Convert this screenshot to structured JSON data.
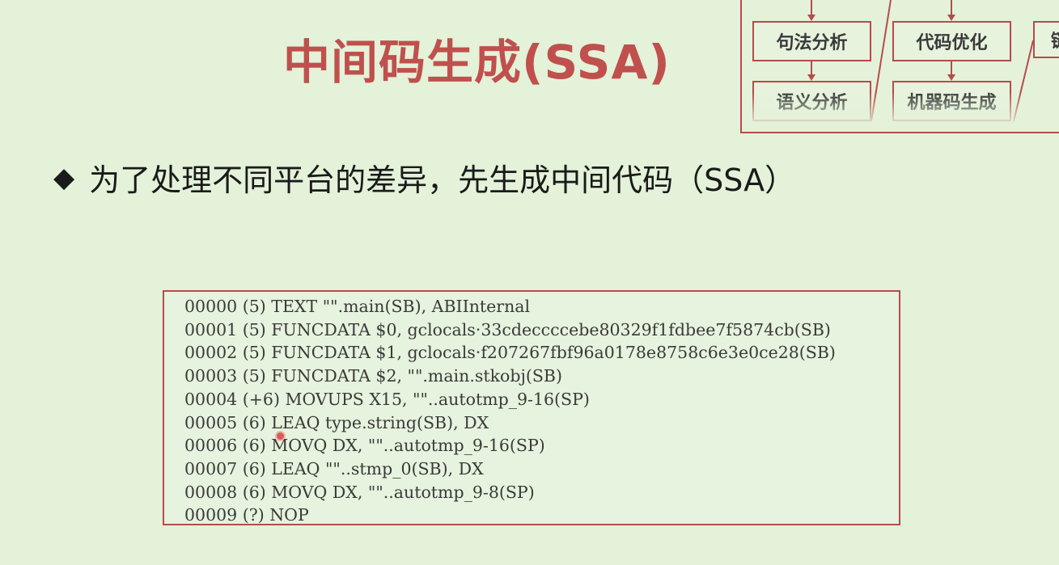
{
  "slide": {
    "title": "中间码生成(SSA)",
    "bullet_icon": "diamond-bullet-icon",
    "bullet_text": "为了处理不同平台的差异，先生成中间代码（SSA）"
  },
  "flowchart": {
    "boxes": [
      {
        "label": "句法分析"
      },
      {
        "label": "代码优化"
      },
      {
        "label": "语义分析"
      },
      {
        "label": "机器码生成"
      },
      {
        "label": "链"
      }
    ]
  },
  "code_lines": [
    "00000 (5) TEXT \"\".main(SB), ABIInternal",
    "00001 (5) FUNCDATA $0, gclocals·33cdeccccebe80329f1fdbee7f5874cb(SB)",
    "00002 (5) FUNCDATA $1, gclocals·f207267fbf96a0178e8758c6e3e0ce28(SB)",
    "00003 (5) FUNCDATA $2, \"\".main.stkobj(SB)",
    "00004 (+6) MOVUPS X15, \"\"..autotmp_9-16(SP)",
    "00005 (6) LEAQ type.string(SB), DX",
    "00006 (6) MOVQ DX, \"\"..autotmp_9-16(SP)",
    "00007 (6) LEAQ \"\"..stmp_0(SB), DX",
    "00008 (6) MOVQ DX, \"\"..autotmp_9-8(SP)",
    "00009 (?) NOP"
  ],
  "colors": {
    "background": "#e3f2d9",
    "accent": "#c0504d",
    "border": "#b74b4b"
  }
}
